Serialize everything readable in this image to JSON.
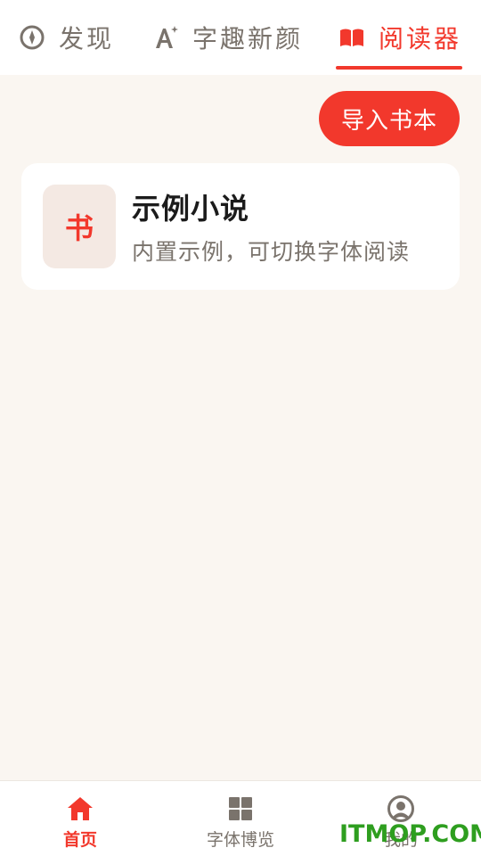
{
  "top_tabs": {
    "discover": {
      "label": "发现",
      "icon": "compass-icon"
    },
    "font_new": {
      "label": "字趣新颜",
      "icon": "font-sparkle-icon"
    },
    "reader": {
      "label": "阅读器",
      "icon": "open-book-icon",
      "active": true
    }
  },
  "import_button": {
    "label": "导入书本"
  },
  "books": [
    {
      "cover_glyph": "书",
      "title": "示例小说",
      "description": "内置示例，可切换字体阅读"
    }
  ],
  "bottom_nav": {
    "home": {
      "label": "首页",
      "icon": "home-icon",
      "active": true
    },
    "fonts": {
      "label": "字体博览",
      "icon": "grid-icon"
    },
    "me": {
      "label": "我的",
      "icon": "user-circle-icon"
    }
  },
  "watermark": {
    "text": "ITMOP.COM"
  },
  "colors": {
    "accent": "#f2382c",
    "background": "#faf6f1",
    "muted_text": "#7a736c",
    "cover_bg": "#f4e9e3",
    "watermark": "#2e9e1f"
  }
}
